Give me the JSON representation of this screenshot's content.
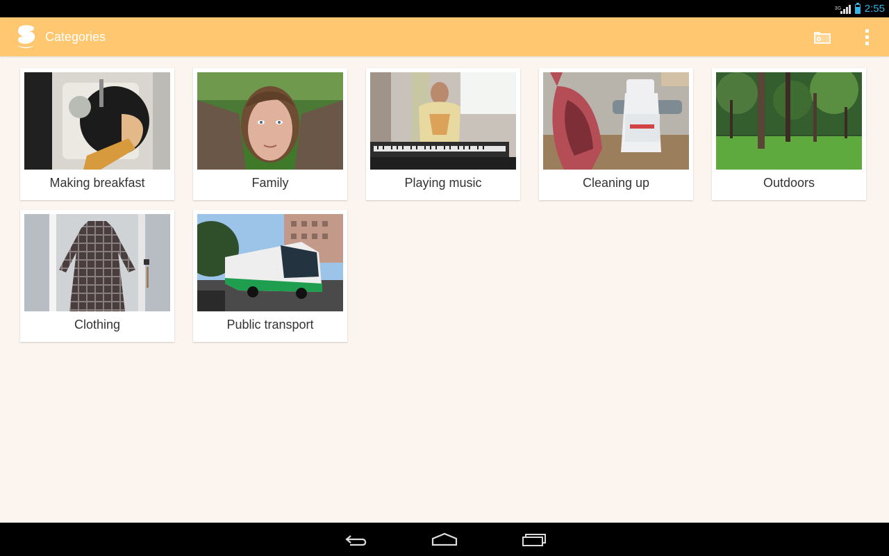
{
  "status_bar": {
    "network_type": "3G",
    "time": "2:55",
    "icons": [
      "signal-icon",
      "battery-icon"
    ]
  },
  "action_bar": {
    "title": "Categories",
    "icons": [
      "app-logo-icon",
      "folder-icon",
      "overflow-menu-icon"
    ]
  },
  "categories": [
    {
      "label": "Making breakfast",
      "image": "person washing dishes at sink"
    },
    {
      "label": "Family",
      "image": "woman portrait outdoors"
    },
    {
      "label": "Playing music",
      "image": "man playing keyboard"
    },
    {
      "label": "Cleaning up",
      "image": "dustpan and spray bottle"
    },
    {
      "label": "Outdoors",
      "image": "park with trees"
    },
    {
      "label": "Clothing",
      "image": "plaid dress on hanger"
    },
    {
      "label": "Public transport",
      "image": "green and white city bus"
    }
  ],
  "nav_bar": {
    "icons": [
      "back-icon",
      "home-icon",
      "recent-apps-icon"
    ]
  },
  "colors": {
    "action_bar": "#ffc76f",
    "background": "#fcf4ee",
    "accent": "#33b5e5"
  }
}
